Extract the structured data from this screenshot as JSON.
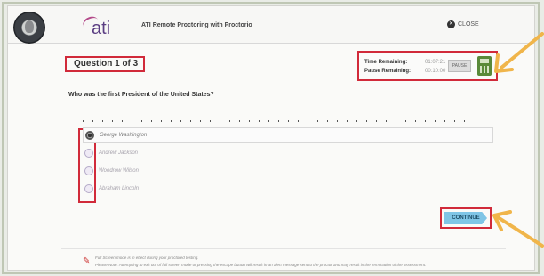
{
  "header": {
    "app_title": "ATI Remote Proctoring with Proctorio",
    "logo_text": "ati",
    "close_label": "CLOSE"
  },
  "question": {
    "counter": "Question 1 of 3",
    "prompt": "Who was the first President of the United States?"
  },
  "timer": {
    "time_remaining_label": "Time Remaining:",
    "time_remaining_value": "01:07:21",
    "pause_remaining_label": "Pause Remaining:",
    "pause_remaining_value": "00:10:00",
    "pause_button": "PAUSE"
  },
  "options": [
    {
      "label": "George Washington",
      "selected": true
    },
    {
      "label": "Andrew Jackson",
      "selected": false
    },
    {
      "label": "Woodrow Wilson",
      "selected": false
    },
    {
      "label": "Abraham Lincoln",
      "selected": false
    }
  ],
  "continue_label": "CONTINUE",
  "footer": {
    "line1": "Full Screen mode is in effect during your proctored testing.",
    "line2": "Please Note: Attempting to exit out of full screen mode or pressing the escape button will result in an alert message sent to the proctor and may result in the termination of the assessment."
  },
  "colors": {
    "highlight": "#d12a3a",
    "arrow": "#f0b54a",
    "continue": "#7fc5e6",
    "logo": "#5a3d82"
  },
  "icons": [
    "avatar",
    "close-icon",
    "calculator-icon",
    "radio-icon",
    "arrow-annotation",
    "warning-icon"
  ]
}
